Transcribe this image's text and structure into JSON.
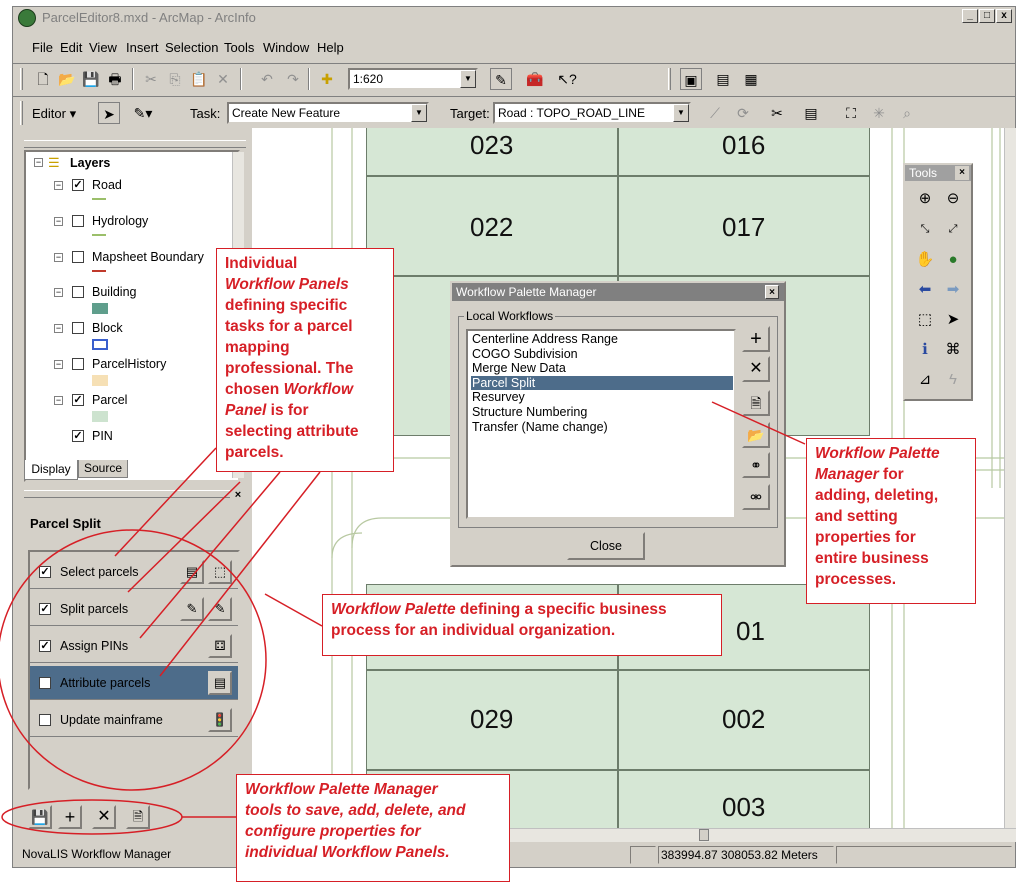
{
  "window": {
    "title": "ParcelEditor8.mxd - ArcMap - ArcInfo",
    "minimize": "_",
    "maximize": "□",
    "close": "x"
  },
  "menu": [
    "File",
    "Edit",
    "View",
    "Insert",
    "Selection",
    "Tools",
    "Window",
    "Help"
  ],
  "toolbar": {
    "scale_value": "1:620",
    "editor_label": "Editor ▾",
    "task_label": "Task:",
    "task_value": "Create New Feature",
    "target_label": "Target:",
    "target_value": "Road : TOPO_ROAD_LINE"
  },
  "toc": {
    "root_label": "Layers",
    "layers": [
      {
        "name": "Road",
        "checked": true,
        "swatch": "#9bbf6a",
        "swatch_type": "line"
      },
      {
        "name": "Hydrology",
        "checked": false,
        "swatch": "#9bbf6a",
        "swatch_type": "line"
      },
      {
        "name": "Mapsheet Boundary",
        "checked": false,
        "swatch": "#c0392b",
        "swatch_type": "line"
      },
      {
        "name": "Building",
        "checked": false,
        "swatch": "#5f9e8c",
        "swatch_type": "fill"
      },
      {
        "name": "Block",
        "checked": false,
        "swatch": "#3a5fcd",
        "swatch_type": "outline"
      },
      {
        "name": "ParcelHistory",
        "checked": false,
        "swatch": "#f6e0b5",
        "swatch_type": "fill"
      },
      {
        "name": "Parcel",
        "checked": true,
        "swatch": "#cde3cf",
        "swatch_type": "fill"
      },
      {
        "name": "PIN",
        "checked": true,
        "swatch": "",
        "swatch_type": "none"
      }
    ],
    "tabs": [
      "Display",
      "Source"
    ]
  },
  "workflow_palette": {
    "title": "Parcel Split",
    "panels": [
      {
        "label": "Select parcels",
        "checked": true,
        "selected": false
      },
      {
        "label": "Split parcels",
        "checked": true,
        "selected": false
      },
      {
        "label": "Assign PINs",
        "checked": true,
        "selected": false
      },
      {
        "label": "Attribute parcels",
        "checked": false,
        "selected": true
      },
      {
        "label": "Update mainframe",
        "checked": false,
        "selected": false
      }
    ]
  },
  "map": {
    "parcels": [
      "023",
      "016",
      "022",
      "017",
      "01",
      "029",
      "002",
      "003"
    ]
  },
  "dialog": {
    "title": "Workflow Palette Manager",
    "group_label": "Local Workflows",
    "items": [
      "Centerline Address Range",
      "COGO Subdivision",
      "Merge New Data",
      "Parcel Split",
      "Resurvey",
      "Structure Numbering",
      "Transfer (Name change)"
    ],
    "selected_index": 3,
    "close_label": "Close"
  },
  "tools_window": {
    "title": "Tools"
  },
  "status": {
    "left": "NovaLIS Workflow Manager",
    "coords": "383994.87  308053.82 Meters"
  },
  "callouts": {
    "panels": [
      "Individual",
      "Workflow Panels",
      "defining specific",
      "tasks for a parcel",
      "mapping",
      "professional.  The",
      "chosen ",
      "Workflow",
      "Panel",
      " is for",
      "selecting attribute",
      "parcels."
    ],
    "manager": [
      "Workflow Palette",
      "Manager",
      " for",
      "adding, deleting,",
      "and setting",
      "properties for",
      "entire business",
      "processes."
    ],
    "palette_a": "Workflow Palette",
    "palette_b": " defining a specific business",
    "palette_c": "process for an individual organization.",
    "tools_a": "Workflow Palette Manager",
    "tools_b": "tools to save, add, delete, and",
    "tools_c": "configure properties for",
    "tools_d": "individual Workflow Panels."
  },
  "colors": {
    "callout_red": "#d61f26",
    "parcel_fill": "#d6e7d5",
    "selection_blue": "#4d6c8a"
  }
}
